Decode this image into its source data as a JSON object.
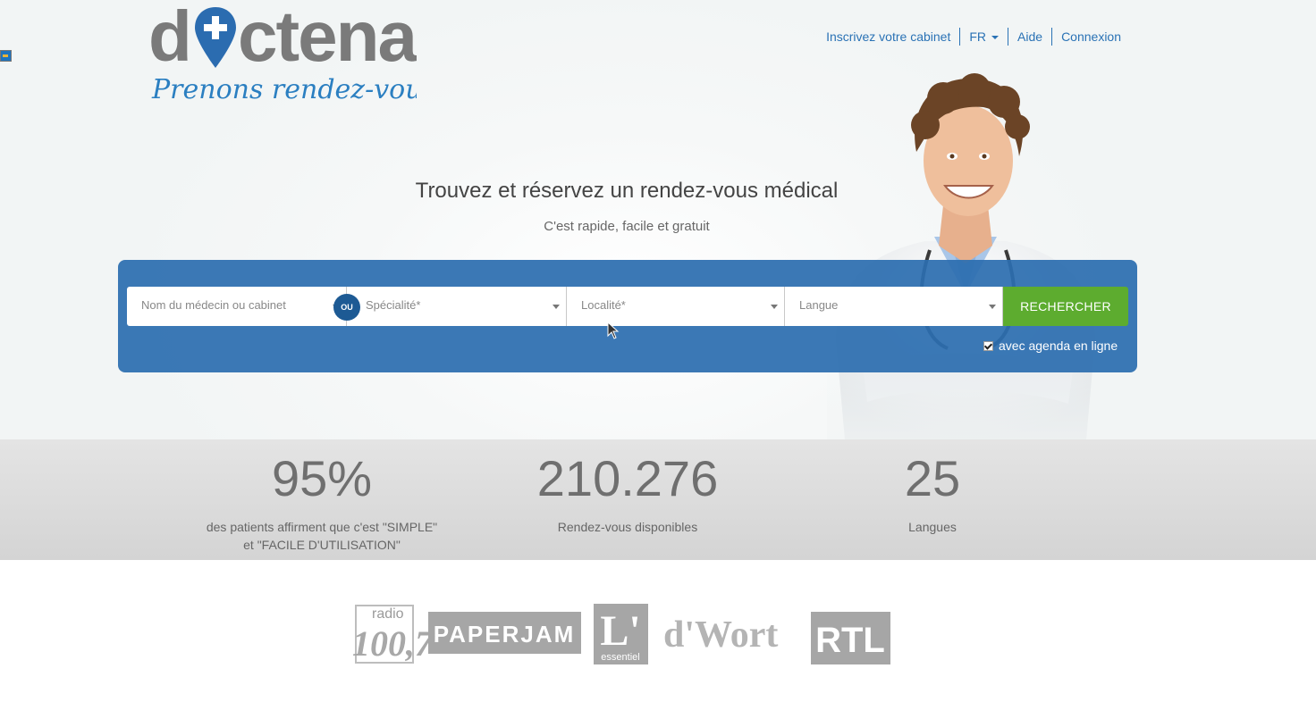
{
  "brand": {
    "name": "doctena",
    "tagline": "Prenons rendez-vous"
  },
  "nav": {
    "register": "Inscrivez votre cabinet",
    "language": "FR",
    "help": "Aide",
    "login": "Connexion"
  },
  "hero": {
    "title": "Trouvez et réservez un rendez-vous médical",
    "subtitle": "C'est rapide, facile et gratuit"
  },
  "search": {
    "doctor_placeholder": "Nom du médecin ou cabinet",
    "or_label": "OU",
    "specialty_placeholder": "Spécialité*",
    "location_placeholder": "Localité*",
    "language_placeholder": "Langue",
    "button_label": "RECHERCHER",
    "online_agenda_label": "avec agenda en ligne",
    "online_agenda_checked": true
  },
  "stats": [
    {
      "value": "95%",
      "label": "des patients affirment que c'est \"SIMPLE\"\net \"FACILE D'UTILISATION\""
    },
    {
      "value": "210.276",
      "label": "Rendez-vous disponibles"
    },
    {
      "value": "25",
      "label": "Langues"
    }
  ],
  "press_logos": [
    "radio 100,7",
    "PAPERJAM",
    "L'essentiel",
    "d'Wort",
    "RTL"
  ],
  "colors": {
    "panel_blue": "#2c6eaf",
    "button_green": "#5dac2f",
    "link_blue": "#2a72b5",
    "logo_grey": "#7a7a7a",
    "logo_blue": "#2b6cb0"
  }
}
